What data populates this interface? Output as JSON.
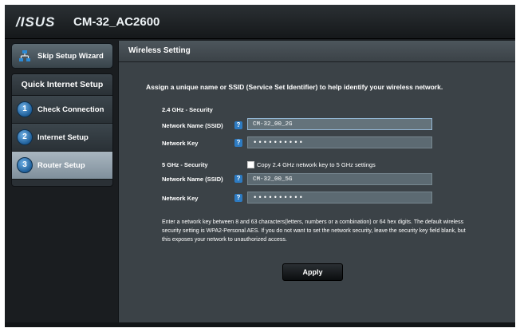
{
  "header": {
    "brand": "/ISUS",
    "model": "CM-32_AC2600"
  },
  "sidebar": {
    "skip_label": "Skip Setup Wizard",
    "quick_title": "Quick Internet Setup",
    "items": [
      {
        "num": "1",
        "label": "Check Connection"
      },
      {
        "num": "2",
        "label": "Internet Setup"
      },
      {
        "num": "3",
        "label": "Router Setup"
      }
    ]
  },
  "main": {
    "title": "Wireless Setting",
    "intro": "Assign a unique name or SSID (Service Set Identifier) to help identify your wireless network.",
    "section24": "2.4 GHz - Security",
    "section5": "5 GHz - Security",
    "ssid_label": "Network Name (SSID)",
    "key_label": "Network Key",
    "ssid_24": "CM-32_00_2G",
    "key_24": "••••••••••",
    "ssid_5": "CM-32_00_5G",
    "key_5": "••••••••••",
    "copy_label": "Copy 2.4 GHz network key to 5 GHz settings",
    "note": "Enter a network key between 8 and 63 characters(letters, numbers or a combination) or 64 hex digits. The default wireless security setting is WPA2-Personal AES. If you do not want to set the network security, leave the security key field blank, but this exposes your network to unauthorized access.",
    "apply_label": "Apply",
    "help_mark": "?"
  },
  "colors": {
    "accent": "#2d7bc2",
    "panel": "#3b4247"
  }
}
